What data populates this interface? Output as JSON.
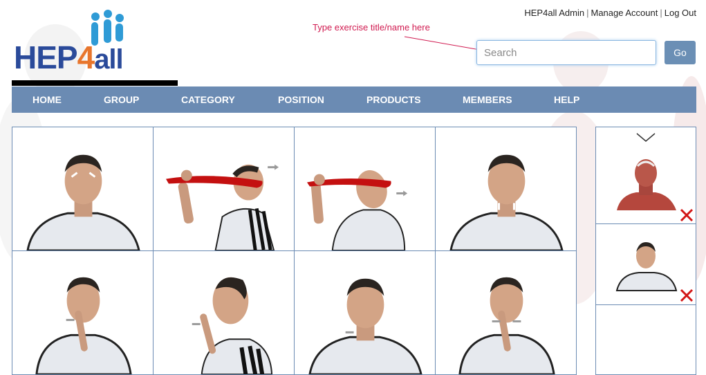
{
  "brand": {
    "word_hep": "HEP",
    "word_four": "4",
    "word_all": "all"
  },
  "topnav": {
    "user": "HEP4all Admin",
    "manage": "Manage Account",
    "logout": "Log Out"
  },
  "annotation": "Type exercise title/name here",
  "search": {
    "placeholder": "Search",
    "value": "",
    "go_label": "Go"
  },
  "nav": [
    "HOME",
    "GROUP",
    "CATEGORY",
    "POSITION",
    "PRODUCTS",
    "MEMBERS",
    "HELP"
  ],
  "colors": {
    "nav_bg": "#6b8bb3",
    "accent_text": "#d0194f",
    "logo_blue": "#2a4a9a",
    "logo_orange": "#e8762d",
    "go_button": "#6b8fb5"
  },
  "exercise_tiles": [
    {
      "pose": "face-front",
      "icon": "eyebrow-arrows-icon"
    },
    {
      "pose": "towel-neck-right",
      "icon": "arrow-right-icon"
    },
    {
      "pose": "towel-neck-tilt",
      "icon": "arrow-right-icon"
    },
    {
      "pose": "face-front",
      "icon": "jaw-arrows-icon"
    },
    {
      "pose": "finger-chin",
      "icon": "arrow-right-icon"
    },
    {
      "pose": "finger-chin-side",
      "icon": "arrow-right-icon"
    },
    {
      "pose": "face-front",
      "icon": "arrow-left-icon"
    },
    {
      "pose": "finger-chin",
      "icon": "arrow-pair-icon"
    }
  ],
  "selected_items": [
    {
      "thumb": "muscle-anatomy",
      "remove_icon": "close-icon"
    },
    {
      "thumb": "face-front",
      "remove_icon": "close-icon"
    }
  ]
}
